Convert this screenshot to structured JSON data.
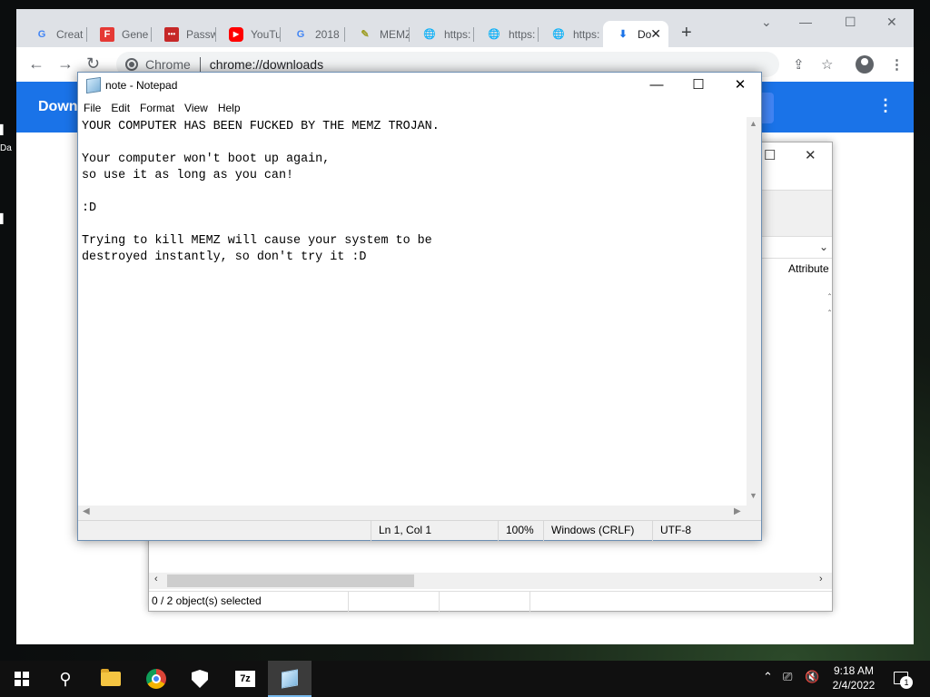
{
  "desktop": {
    "icon_stub_label": "Da"
  },
  "browser": {
    "tabs": [
      {
        "label": "Creat",
        "fav": "G"
      },
      {
        "label": "Gene",
        "fav": "F"
      },
      {
        "label": "Passw",
        "fav": "•••"
      },
      {
        "label": "YouTu",
        "fav": "▶"
      },
      {
        "label": "2018",
        "fav": "G"
      },
      {
        "label": "MEMZ",
        "fav": "✎"
      },
      {
        "label": "https:",
        "fav": "🌐"
      },
      {
        "label": "https:",
        "fav": "🌐"
      },
      {
        "label": "https:",
        "fav": "🌐"
      },
      {
        "label": "Do",
        "fav": "⬇"
      }
    ],
    "new_tab": "+",
    "omnibox": {
      "chip": "Chrome",
      "url": "chrome://downloads"
    },
    "page_title": "Down",
    "colors": {
      "header": "#1a73e8"
    }
  },
  "explorer": {
    "column_header": "Attribute",
    "status": "0 / 2 object(s) selected"
  },
  "notepad": {
    "title": "note - Notepad",
    "menu": [
      "File",
      "Edit",
      "Format",
      "View",
      "Help"
    ],
    "content": "YOUR COMPUTER HAS BEEN FUCKED BY THE MEMZ TROJAN.\n\nYour computer won't boot up again,\nso use it as long as you can!\n\n:D\n\nTrying to kill MEMZ will cause your system to be\ndestroyed instantly, so don't try it :D",
    "status": {
      "position": "Ln 1, Col 1",
      "zoom": "100%",
      "line_ending": "Windows (CRLF)",
      "encoding": "UTF-8"
    }
  },
  "taskbar": {
    "apps": [
      "start-icon",
      "search-icon",
      "file-explorer-icon",
      "chrome-icon",
      "defender-icon",
      "7zip-icon",
      "notepad-icon"
    ],
    "zip_label": "7z",
    "time": "9:18 AM",
    "date": "2/4/2022",
    "notification_count": "1"
  }
}
